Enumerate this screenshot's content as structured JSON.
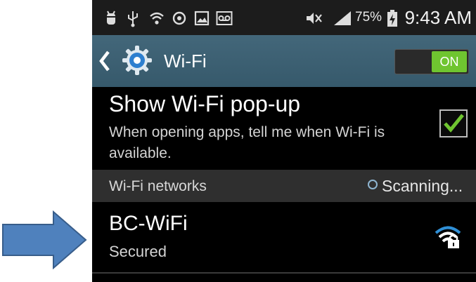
{
  "status_bar": {
    "icons": [
      "usb-debug-icon",
      "usb-icon",
      "wifi-status-icon",
      "location-icon",
      "gallery-icon",
      "voicemail-icon",
      "mute-icon",
      "signal-icon",
      "battery-icon"
    ],
    "battery_percent": "75%",
    "time": "9:43 AM"
  },
  "action_bar": {
    "title": "Wi-Fi",
    "toggle_label": "ON",
    "toggle_on": true,
    "accent_color": "#6fc530",
    "bar_color": "#3e6275"
  },
  "popup_setting": {
    "title": "Show Wi-Fi pop-up",
    "description": "When opening apps, tell me when Wi-Fi is available.",
    "checked": true
  },
  "networks_section": {
    "title": "Wi-Fi networks",
    "scanning_label": "Scanning..."
  },
  "networks": [
    {
      "name": "BC-WiFi",
      "status": "Secured",
      "icon": "wifi-lock-icon"
    }
  ],
  "annotation": {
    "arrow_color": "#4f81bd",
    "icon": "right-arrow-icon"
  }
}
